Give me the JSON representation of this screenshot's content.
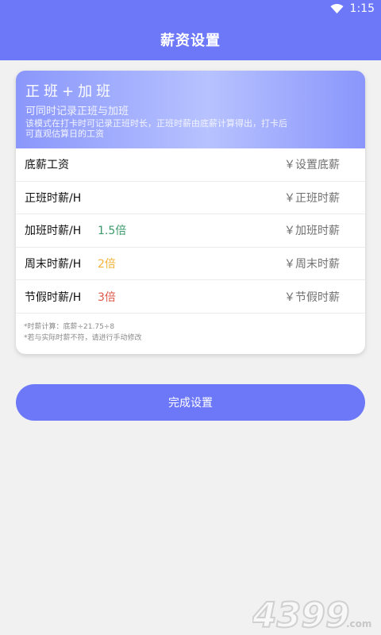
{
  "status_bar": {
    "time": "1:15",
    "wifi_icon": "wifi-icon"
  },
  "app_bar": {
    "title": "薪资设置"
  },
  "mode": {
    "title": "正班+加班",
    "subtitle": "可同时记录正班与加班",
    "description": "该模式在打卡时可记录正班时长，正班时薪由底薪计算得出，打卡后可直观估算日的工资"
  },
  "rows": [
    {
      "label": "底薪工资",
      "multiplier": "",
      "placeholder": "￥设置底薪"
    },
    {
      "label": "正班时薪/H",
      "multiplier": "",
      "placeholder": "￥正班时薪"
    },
    {
      "label": "加班时薪/H",
      "multiplier": "1.5倍",
      "multiplier_color": "#3c9a6a",
      "placeholder": "￥加班时薪"
    },
    {
      "label": "周末时薪/H",
      "multiplier": "2倍",
      "multiplier_color": "#f3b33b",
      "placeholder": "￥周末时薪"
    },
    {
      "label": "节假时薪/H",
      "multiplier": "3倍",
      "multiplier_color": "#e0584a",
      "placeholder": "￥节假时薪"
    }
  ],
  "notes": [
    "*时薪计算：底薪÷21.75÷8",
    "*若与实际时薪不符，请进行手动修改"
  ],
  "done_button": "完成设置",
  "watermark": {
    "text": "4399",
    "suffix": ".com"
  },
  "colors": {
    "primary": "#6c78f8",
    "background": "#f1f1f1"
  }
}
